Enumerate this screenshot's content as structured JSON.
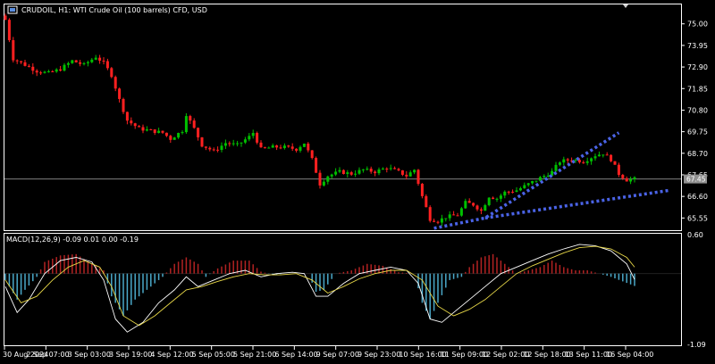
{
  "header": {
    "symbol_info": "CRUDOIL, H1:  WTI Crude Oil (100 barrels) CFD, USD"
  },
  "indicator": {
    "label": "MACD(12,26,9) -0.09 0.01 0.00 -0.19"
  },
  "colors": {
    "background": "#000000",
    "bull_candle": "#00c000",
    "bear_candle": "#ff2020",
    "trendline": "#4a63e6",
    "hist_positive": "#b22222",
    "hist_negative": "#4aa8c8",
    "macd_line": "#ffffff",
    "signal_line": "#e8d848",
    "current_price_line": "#808080",
    "price_tag": "#909090"
  },
  "chart_data": [
    {
      "type": "candlestick",
      "title": "CRUDOIL, H1",
      "current_price": 67.45,
      "current_price_label": "67.45",
      "ylim": [
        65.0,
        75.9
      ],
      "y_ticks": [
        "75.00",
        "73.95",
        "72.90",
        "71.85",
        "70.80",
        "69.75",
        "68.70",
        "67.65",
        "66.60",
        "65.55"
      ],
      "x_tick_labels": [
        "30 Aug 2024",
        "2 Sep 07:00",
        "3 Sep 03:00",
        "3 Sep 19:00",
        "4 Sep 12:00",
        "5 Sep 05:00",
        "5 Sep 21:00",
        "6 Sep 14:00",
        "9 Sep 07:00",
        "9 Sep 23:00",
        "10 Sep 16:00",
        "11 Sep 09:00",
        "12 Sep 02:00",
        "12 Sep 18:00",
        "13 Sep 11:00",
        "16 Sep 04:00"
      ],
      "close_path": [
        [
          0,
          75.2
        ],
        [
          2,
          73.3
        ],
        [
          5,
          73.0
        ],
        [
          8,
          72.7
        ],
        [
          11,
          72.6
        ],
        [
          14,
          72.8
        ],
        [
          17,
          73.2
        ],
        [
          20,
          73.0
        ],
        [
          23,
          73.4
        ],
        [
          25,
          73.1
        ],
        [
          27,
          72.5
        ],
        [
          29,
          71.3
        ],
        [
          31,
          70.3
        ],
        [
          34,
          69.9
        ],
        [
          37,
          69.8
        ],
        [
          40,
          69.7
        ],
        [
          42,
          69.4
        ],
        [
          45,
          69.8
        ],
        [
          46,
          70.6
        ],
        [
          48,
          69.9
        ],
        [
          50,
          69.1
        ],
        [
          53,
          68.8
        ],
        [
          56,
          69.2
        ],
        [
          59,
          69.1
        ],
        [
          62,
          69.5
        ],
        [
          63,
          69.7
        ],
        [
          65,
          68.9
        ],
        [
          68,
          69.0
        ],
        [
          71,
          69.0
        ],
        [
          74,
          68.9
        ],
        [
          76,
          69.2
        ],
        [
          78,
          68.4
        ],
        [
          80,
          67.2
        ],
        [
          82,
          67.6
        ],
        [
          85,
          67.8
        ],
        [
          88,
          67.7
        ],
        [
          91,
          67.9
        ],
        [
          94,
          67.8
        ],
        [
          97,
          68.0
        ],
        [
          100,
          67.8
        ],
        [
          102,
          67.6
        ],
        [
          104,
          67.9
        ],
        [
          106,
          66.6
        ],
        [
          108,
          65.5
        ],
        [
          110,
          65.4
        ],
        [
          112,
          65.6
        ],
        [
          115,
          65.7
        ],
        [
          117,
          66.3
        ],
        [
          119,
          66.2
        ],
        [
          121,
          65.9
        ],
        [
          123,
          66.6
        ],
        [
          125,
          66.5
        ],
        [
          127,
          66.8
        ],
        [
          130,
          66.9
        ],
        [
          133,
          67.2
        ],
        [
          136,
          67.5
        ],
        [
          139,
          67.8
        ],
        [
          141,
          68.3
        ],
        [
          144,
          68.4
        ],
        [
          147,
          68.3
        ],
        [
          150,
          68.6
        ],
        [
          152,
          68.7
        ],
        [
          154,
          68.4
        ],
        [
          156,
          67.7
        ],
        [
          158,
          67.4
        ],
        [
          160,
          67.45
        ]
      ],
      "trendlines": [
        {
          "name": "",
          "points": [
            [
              109,
              65.05
            ],
            [
              122,
              65.55
            ],
            [
              156,
              69.7
            ]
          ]
        },
        {
          "name": "",
          "points": [
            [
              122,
              65.55
            ],
            [
              169,
              66.9
            ]
          ]
        }
      ],
      "annotation_lines": [
        {
          "orientation": "horizontal",
          "value": 67.45
        }
      ]
    },
    {
      "type": "macd",
      "title": "MACD(12,26,9)",
      "ylim": [
        -1.09,
        0.6
      ],
      "y_ticks": [
        "0.60",
        "-1.09"
      ],
      "histogram_path": [
        [
          0,
          -0.1
        ],
        [
          3,
          -0.4
        ],
        [
          5,
          -0.25
        ],
        [
          8,
          -0.05
        ],
        [
          10,
          0.18
        ],
        [
          14,
          0.28
        ],
        [
          18,
          0.3
        ],
        [
          22,
          0.15
        ],
        [
          25,
          0.05
        ],
        [
          27,
          -0.35
        ],
        [
          30,
          -0.65
        ],
        [
          33,
          -0.4
        ],
        [
          37,
          -0.2
        ],
        [
          40,
          -0.05
        ],
        [
          43,
          0.15
        ],
        [
          46,
          0.25
        ],
        [
          49,
          0.15
        ],
        [
          51,
          -0.05
        ],
        [
          54,
          0.08
        ],
        [
          58,
          0.2
        ],
        [
          62,
          0.2
        ],
        [
          65,
          0.03
        ],
        [
          68,
          -0.02
        ],
        [
          71,
          0.0
        ],
        [
          74,
          0.0
        ],
        [
          77,
          0.0
        ],
        [
          79,
          -0.28
        ],
        [
          81,
          -0.25
        ],
        [
          84,
          0.0
        ],
        [
          88,
          0.05
        ],
        [
          92,
          0.15
        ],
        [
          96,
          0.12
        ],
        [
          100,
          0.02
        ],
        [
          104,
          0.0
        ],
        [
          106,
          -0.45
        ],
        [
          108,
          -0.7
        ],
        [
          110,
          -0.45
        ],
        [
          113,
          -0.1
        ],
        [
          116,
          -0.05
        ],
        [
          118,
          0.1
        ],
        [
          121,
          0.25
        ],
        [
          124,
          0.3
        ],
        [
          127,
          0.15
        ],
        [
          130,
          0.0
        ],
        [
          133,
          0.05
        ],
        [
          136,
          0.1
        ],
        [
          139,
          0.2
        ],
        [
          142,
          0.1
        ],
        [
          145,
          0.05
        ],
        [
          148,
          0.05
        ],
        [
          151,
          0.0
        ],
        [
          154,
          -0.05
        ],
        [
          157,
          -0.12
        ],
        [
          160,
          -0.19
        ]
      ],
      "macd_path": [
        [
          0,
          -0.2
        ],
        [
          3,
          -0.6
        ],
        [
          6,
          -0.4
        ],
        [
          10,
          0.0
        ],
        [
          14,
          0.2
        ],
        [
          18,
          0.25
        ],
        [
          22,
          0.18
        ],
        [
          25,
          -0.1
        ],
        [
          28,
          -0.7
        ],
        [
          31,
          -0.9
        ],
        [
          35,
          -0.75
        ],
        [
          39,
          -0.45
        ],
        [
          43,
          -0.25
        ],
        [
          46,
          -0.05
        ],
        [
          49,
          -0.2
        ],
        [
          53,
          -0.1
        ],
        [
          57,
          0.0
        ],
        [
          61,
          0.05
        ],
        [
          65,
          -0.05
        ],
        [
          69,
          0.0
        ],
        [
          73,
          0.02
        ],
        [
          76,
          0.0
        ],
        [
          79,
          -0.35
        ],
        [
          82,
          -0.35
        ],
        [
          86,
          -0.15
        ],
        [
          90,
          0.0
        ],
        [
          94,
          0.05
        ],
        [
          98,
          0.1
        ],
        [
          102,
          0.05
        ],
        [
          105,
          -0.15
        ],
        [
          108,
          -0.7
        ],
        [
          111,
          -0.75
        ],
        [
          114,
          -0.6
        ],
        [
          118,
          -0.4
        ],
        [
          122,
          -0.2
        ],
        [
          126,
          0.0
        ],
        [
          130,
          0.1
        ],
        [
          134,
          0.2
        ],
        [
          138,
          0.3
        ],
        [
          142,
          0.38
        ],
        [
          146,
          0.45
        ],
        [
          150,
          0.43
        ],
        [
          154,
          0.35
        ],
        [
          158,
          0.15
        ],
        [
          160,
          -0.09
        ]
      ],
      "signal_path": [
        [
          0,
          -0.1
        ],
        [
          4,
          -0.45
        ],
        [
          8,
          -0.35
        ],
        [
          12,
          -0.1
        ],
        [
          16,
          0.1
        ],
        [
          20,
          0.2
        ],
        [
          24,
          0.1
        ],
        [
          27,
          -0.2
        ],
        [
          30,
          -0.65
        ],
        [
          34,
          -0.8
        ],
        [
          38,
          -0.65
        ],
        [
          42,
          -0.45
        ],
        [
          46,
          -0.25
        ],
        [
          50,
          -0.2
        ],
        [
          54,
          -0.12
        ],
        [
          58,
          -0.05
        ],
        [
          62,
          0.0
        ],
        [
          66,
          -0.02
        ],
        [
          70,
          -0.02
        ],
        [
          74,
          0.0
        ],
        [
          78,
          -0.1
        ],
        [
          82,
          -0.3
        ],
        [
          86,
          -0.2
        ],
        [
          90,
          -0.08
        ],
        [
          94,
          0.0
        ],
        [
          98,
          0.05
        ],
        [
          102,
          0.05
        ],
        [
          106,
          -0.1
        ],
        [
          110,
          -0.5
        ],
        [
          114,
          -0.65
        ],
        [
          118,
          -0.55
        ],
        [
          122,
          -0.4
        ],
        [
          126,
          -0.2
        ],
        [
          130,
          0.0
        ],
        [
          134,
          0.12
        ],
        [
          138,
          0.22
        ],
        [
          142,
          0.32
        ],
        [
          146,
          0.4
        ],
        [
          150,
          0.42
        ],
        [
          154,
          0.38
        ],
        [
          158,
          0.25
        ],
        [
          160,
          0.1
        ]
      ],
      "annotation_lines": [
        {
          "orientation": "horizontal",
          "value": 0.0
        }
      ]
    }
  ]
}
